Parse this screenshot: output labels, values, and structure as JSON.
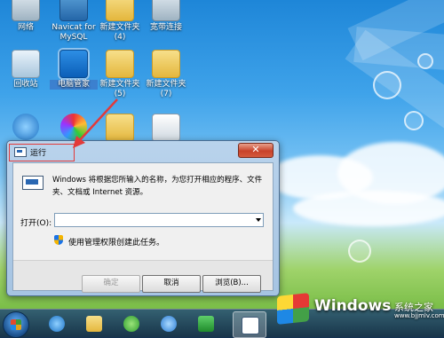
{
  "desktop": {
    "icons": [
      {
        "label": "网络"
      },
      {
        "label": "Navicat for MySQL"
      },
      {
        "label": "新建文件夹 (4)"
      },
      {
        "label": "宽带连接"
      },
      {
        "label": "回收站"
      },
      {
        "label": "电脑管家"
      },
      {
        "label": "新建文件夹 (5)"
      },
      {
        "label": "新建文件夹 (7)"
      }
    ]
  },
  "dialog": {
    "title": "运行",
    "description": "Windows 将根据您所输入的名称，为您打开相应的程序、文件夹、文档或 Internet 资源。",
    "open_label": "打开(O):",
    "open_value": "",
    "admin_note": "使用管理权限创建此任务。",
    "ok_label": "确定",
    "cancel_label": "取消",
    "browse_label": "浏览(B)...",
    "close_glyph": "✕"
  },
  "watermark": {
    "brand": "Windows",
    "cn": "系统之家",
    "url": "www.bjjmlv.com"
  },
  "colors": {
    "highlight": "#e23a3a",
    "close": "#c8422a"
  }
}
